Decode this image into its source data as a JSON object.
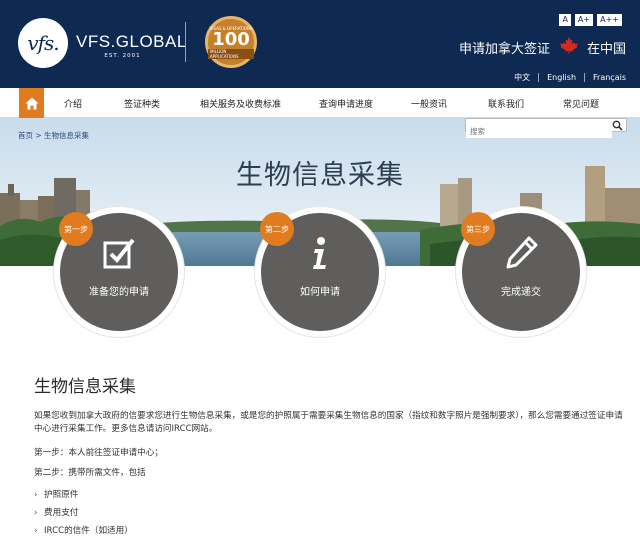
{
  "brand": {
    "logo_mark": "vfs.",
    "name": "VFS.GLOBAL",
    "est": "EST. 2001",
    "badge": {
      "top": "VISAS & OPERATIONS",
      "number": "100",
      "bottom": "MILLION APPLICATIONS"
    }
  },
  "font_sizes": [
    "A",
    "A+",
    "A++"
  ],
  "header": {
    "apply_text": "申请加拿大签证",
    "country_text": "在中国",
    "flag_color": "#d52b1e"
  },
  "languages": [
    "中文",
    "English",
    "Français"
  ],
  "nav": {
    "items": [
      "介绍",
      "签证种类",
      "相关服务及收费标准",
      "查询申请进度",
      "一般资讯",
      "联系我们",
      "常见问题"
    ],
    "accent": "#e07b20"
  },
  "breadcrumb": "首页 > 生物信息采集",
  "search": {
    "placeholder": "搜索"
  },
  "banner_title": "生物信息采集",
  "steps": [
    {
      "badge": "第一步",
      "label": "准备您的申请",
      "icon": "checkbox-icon"
    },
    {
      "badge": "第二步",
      "label": "如何申请",
      "icon": "info-icon"
    },
    {
      "badge": "第三步",
      "label": "完成递交",
      "icon": "pencil-icon"
    }
  ],
  "content": {
    "title": "生物信息采集",
    "paragraph": "如果您收到加拿大政府的信要求您进行生物信息采集，或是您的护照属于需要采集生物信息的国家（指纹和数字照片是强制要求），那么您需要通过签证申请中心进行采集工作。更多信息请访问IRCC网站。",
    "step1": "第一步：本人前往签证申请中心；",
    "step2": "第二步：携带所需文件，包括",
    "bullets": [
      "护照原件",
      "费用支付",
      "IRCC的信件（如适用）"
    ]
  }
}
